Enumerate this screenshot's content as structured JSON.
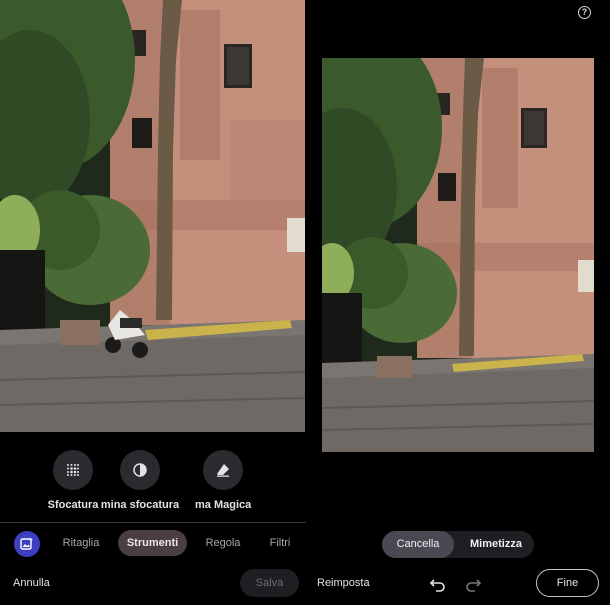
{
  "tools": [
    {
      "label": "Sfocatura",
      "icon": "blur-icon"
    },
    {
      "label": "mina sfocatura",
      "icon": "remove-blur-icon"
    },
    {
      "label": "ma Magica",
      "icon": "magic-eraser-icon"
    }
  ],
  "tabs": {
    "ritaglia": "Ritaglia",
    "strumenti": "Strumenti",
    "regola": "Regola",
    "filtri": "Filtri"
  },
  "bottom": {
    "annulla": "Annulla",
    "salva": "Salva",
    "reimposta": "Reimposta",
    "fine": "Fine"
  },
  "segmented": {
    "cancella": "Cancella",
    "mimetizza": "Mimetizza"
  },
  "help_label": "?",
  "colors": {
    "background": "#000000",
    "active_tab": "#4a3d43",
    "app_icon": "#3c3fc1",
    "chip": "#2b2a2f"
  }
}
